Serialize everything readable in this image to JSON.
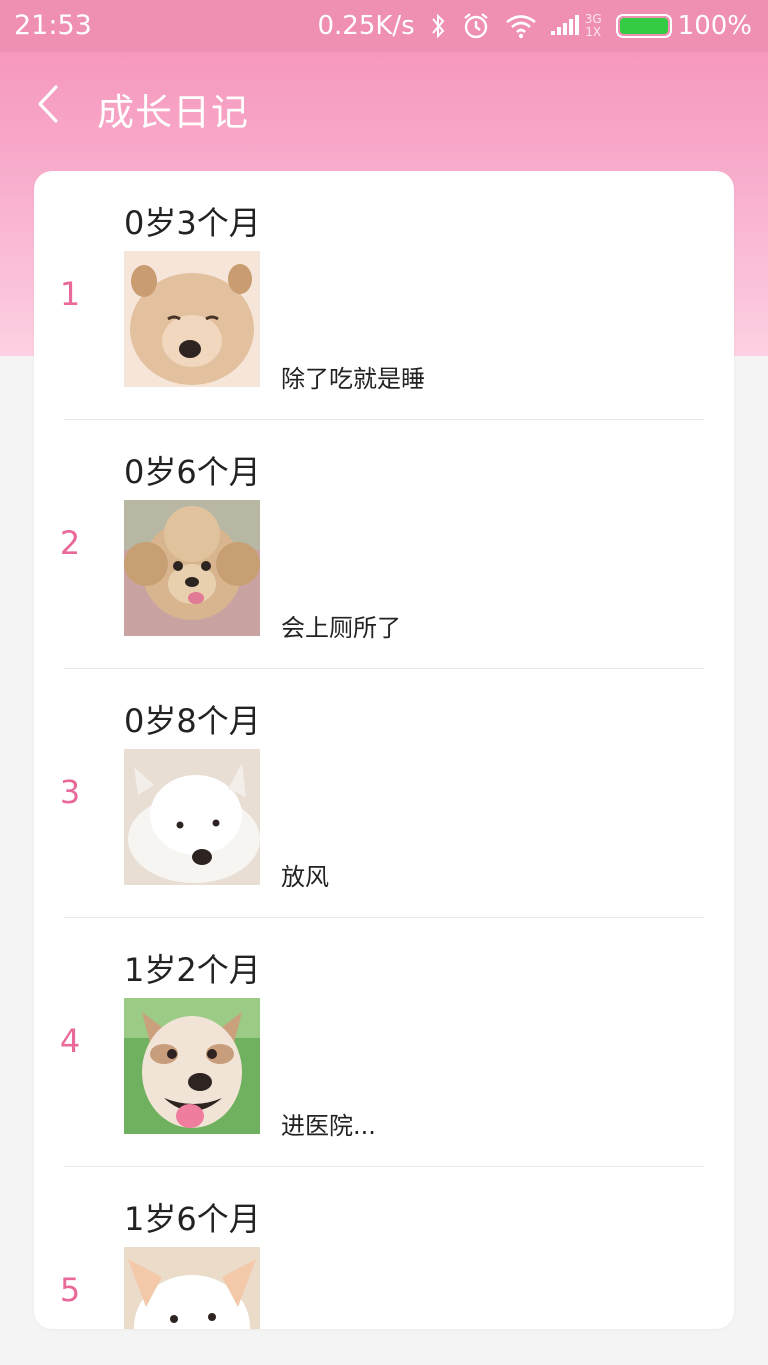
{
  "status": {
    "time": "21:53",
    "net_speed": "0.25K/s",
    "net_type_top": "3G",
    "net_type_bottom": "1X",
    "battery": "100%",
    "battery_level": 1.0
  },
  "nav": {
    "back_icon": "chevron-left-icon",
    "title": "成长日记"
  },
  "colors": {
    "header_top": "#ef8fb3",
    "accent": "#e8699a",
    "battery": "#33cc44"
  },
  "entries": [
    {
      "index": "1",
      "age": "0岁3个月",
      "note": "除了吃就是睡",
      "photo": "chow-puppy-photo"
    },
    {
      "index": "2",
      "age": "0岁6个月",
      "note": "会上厕所了",
      "photo": "poodle-photo"
    },
    {
      "index": "3",
      "age": "0岁8个月",
      "note": "放风",
      "photo": "westie-photo"
    },
    {
      "index": "4",
      "age": "1岁2个月",
      "note": "进医院...",
      "photo": "shiba-dog-photo"
    },
    {
      "index": "5",
      "age": "1岁6个月",
      "note": "",
      "photo": "white-dog-photo"
    }
  ]
}
